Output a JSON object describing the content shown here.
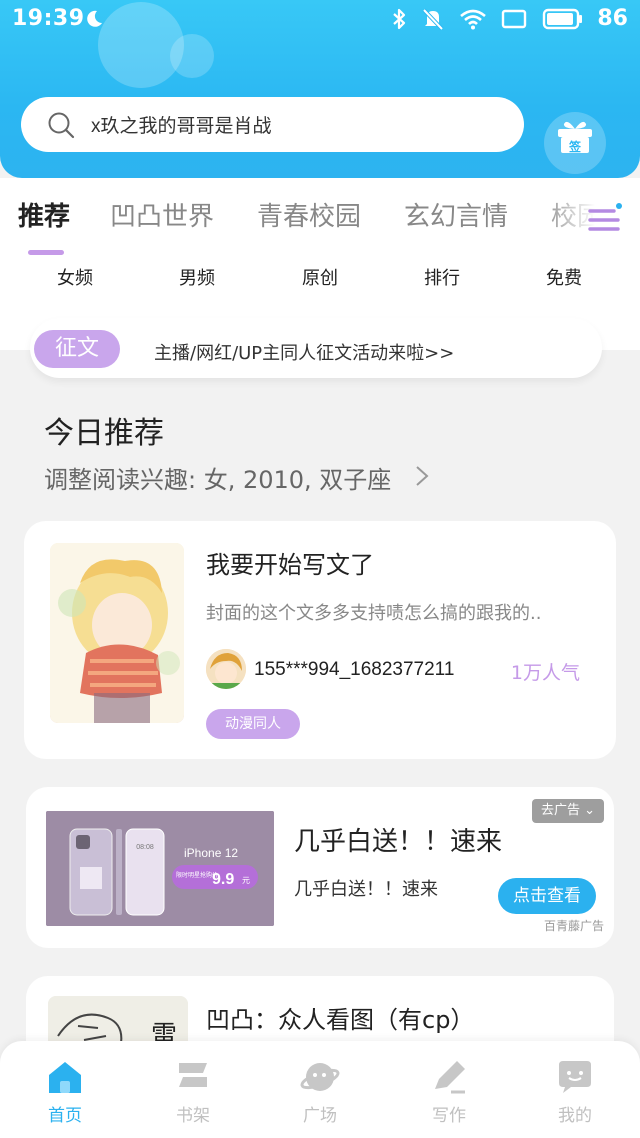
{
  "status_bar": {
    "time": "19:39",
    "battery": "86",
    "icons": [
      "moon-icon",
      "bluetooth-icon",
      "mute-icon",
      "wifi-icon",
      "screen-icon",
      "battery-icon"
    ]
  },
  "search": {
    "text": "x玖之我的哥哥是肖战",
    "icon": "search-icon"
  },
  "sign_in": {
    "label": "签"
  },
  "tabs": [
    {
      "label": "推荐",
      "active": true
    },
    {
      "label": "凹凸世界"
    },
    {
      "label": "青春校园"
    },
    {
      "label": "玄幻言情"
    },
    {
      "label": "校园"
    }
  ],
  "subcategories": [
    "女频",
    "男频",
    "原创",
    "排行",
    "免费"
  ],
  "contest": {
    "tag": "征文",
    "text": "主播/网红/UP主同人征文活动来啦>>"
  },
  "recommend": {
    "title": "今日推荐",
    "subtitle": "调整阅读兴趣: 女, 2010, 双子座"
  },
  "book1": {
    "title": "我要开始写文了",
    "desc": "封面的这个文多多支持啧怎么搞的跟我的..",
    "author": "155***994_1682377211",
    "popularity": "1万人气",
    "tag": "动漫同人"
  },
  "ad": {
    "title": "几乎白送！！速来",
    "desc": "几乎白送！！速来",
    "badge": "去广告",
    "cta": "点击查看",
    "source": "百青藤广告",
    "image_model": "iPhone 12",
    "image_promo": "限时明星抢购价",
    "image_price": "9.9",
    "image_price_unit": "元",
    "image_screen_time": "08:08"
  },
  "book2": {
    "title": "凹凸：众人看图（有cp）",
    "cover_text": "雷"
  },
  "bottom_nav": [
    {
      "label": "首页",
      "icon": "home-icon",
      "active": true
    },
    {
      "label": "书架",
      "icon": "bookshelf-icon"
    },
    {
      "label": "广场",
      "icon": "plaza-icon"
    },
    {
      "label": "写作",
      "icon": "write-icon"
    },
    {
      "label": "我的",
      "icon": "profile-icon"
    }
  ],
  "colors": {
    "accent_blue": "#2bb1ef",
    "accent_purple": "#c59ae8",
    "header_top": "#38c8f6"
  }
}
